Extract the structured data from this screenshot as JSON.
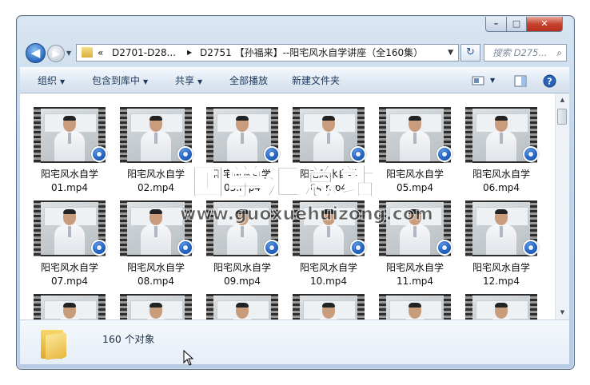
{
  "window": {
    "controls": {
      "minimize": "–",
      "maximize": "□",
      "close": "✕"
    }
  },
  "nav": {
    "back_glyph": "◀",
    "forward_glyph": "▶",
    "dropdown_glyph": "▼"
  },
  "address": {
    "overflow": "«",
    "crumbs": [
      "D2701-D28...",
      "D2751 【孙福来】--阳宅风水自学讲座（全160集）"
    ],
    "sep": "▶",
    "dropdown_glyph": "▼"
  },
  "refresh_glyph": "↻",
  "search": {
    "placeholder": "搜索 D275...",
    "icon": "magnifier-icon"
  },
  "toolbar": {
    "organize": "组织",
    "include_library": "包含到库中",
    "share": "共享",
    "play_all": "全部播放",
    "new_folder": "新建文件夹",
    "arrow": "▼"
  },
  "files": [
    {
      "line1": "阳宅风水自学",
      "line2": "01.mp4"
    },
    {
      "line1": "阳宅风水自学",
      "line2": "02.mp4"
    },
    {
      "line1": "阳宅风水自学",
      "line2": "03.mp4"
    },
    {
      "line1": "阳宅风水自学",
      "line2": "04.mp4"
    },
    {
      "line1": "阳宅风水自学",
      "line2": "05.mp4"
    },
    {
      "line1": "阳宅风水自学",
      "line2": "06.mp4"
    },
    {
      "line1": "阳宅风水自学",
      "line2": "07.mp4"
    },
    {
      "line1": "阳宅风水自学",
      "line2": "08.mp4"
    },
    {
      "line1": "阳宅风水自学",
      "line2": "09.mp4"
    },
    {
      "line1": "阳宅风水自学",
      "line2": "10.mp4"
    },
    {
      "line1": "阳宅风水自学",
      "line2": "11.mp4"
    },
    {
      "line1": "阳宅风水自学",
      "line2": "12.mp4"
    },
    {
      "line1": "",
      "line2": ""
    },
    {
      "line1": "",
      "line2": ""
    },
    {
      "line1": "",
      "line2": ""
    },
    {
      "line1": "",
      "line2": ""
    },
    {
      "line1": "",
      "line2": ""
    },
    {
      "line1": "",
      "line2": ""
    }
  ],
  "status": {
    "count": "160 个对象"
  },
  "watermark": {
    "cn": "国学汇总站",
    "url": "www.guoxuehuizong.com"
  },
  "colors": {
    "accent": "#1e5fbd",
    "toolbar_text": "#1e395b",
    "close": "#c6432f"
  }
}
